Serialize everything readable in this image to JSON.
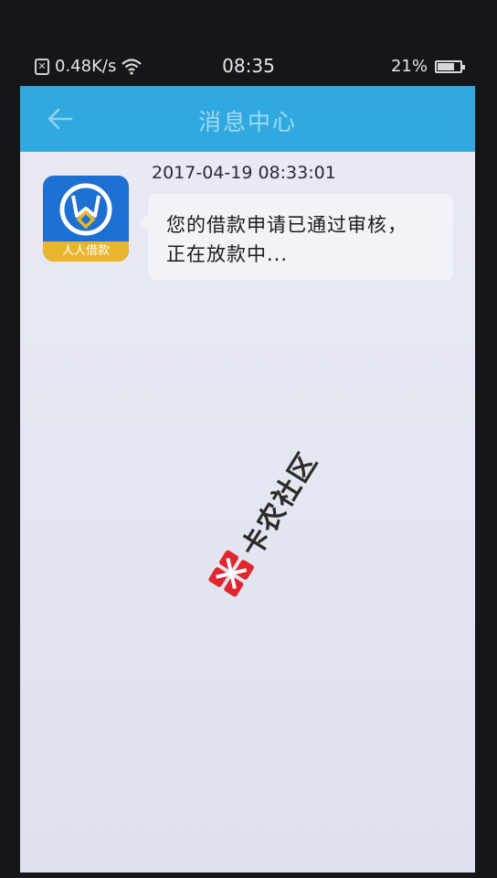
{
  "status_bar": {
    "net_speed": "0.48K/s",
    "time": "08:35",
    "battery": "21%"
  },
  "nav": {
    "title": "消息中心"
  },
  "app": {
    "icon_label": "人人借款"
  },
  "message": {
    "timestamp": "2017-04-19 08:33:01",
    "line1": "您的借款申请已通过审核，",
    "line2": "正在放款中..."
  },
  "watermark": {
    "text": "卡农社区"
  },
  "colors": {
    "nav_bar": "#2fa9df",
    "app_icon": "#1d6fd2",
    "app_icon_band": "#e9b52c",
    "watermark_red": "#e0262e"
  },
  "icons": {
    "back": "arrow-left-icon",
    "wifi": "wifi-icon",
    "battery": "battery-icon",
    "sim": "sim-card-icon"
  }
}
